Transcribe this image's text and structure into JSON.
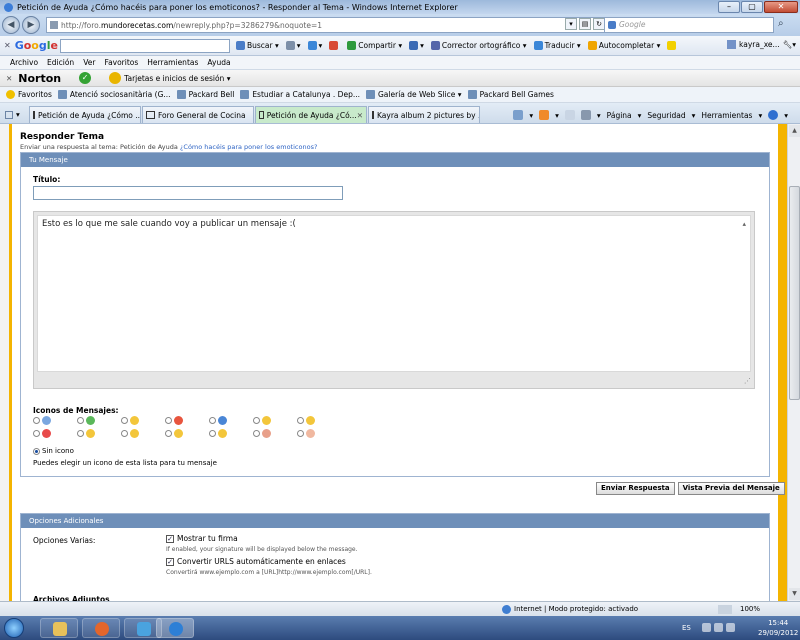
{
  "window": {
    "title": "Petición de Ayuda ¿Cómo hacéis para poner los emoticonos? - Responder al Tema - Windows Internet Explorer"
  },
  "address": {
    "url_prefix": "http://foro.",
    "url_domain": "mundorecetas.com",
    "url_rest": "/newreply.php?p=3286279&noquote=1",
    "search_placeholder": "Google"
  },
  "google_toolbar": {
    "buscar": "Buscar",
    "compartir": "Compartir",
    "corrector": "Corrector ortográfico",
    "traducir": "Traducir",
    "autocompletar": "Autocompletar",
    "user": "kayra_xe..."
  },
  "menu": [
    "Archivo",
    "Edición",
    "Ver",
    "Favoritos",
    "Herramientas",
    "Ayuda"
  ],
  "norton": {
    "logo": "Norton",
    "tarjetas": "Tarjetas e inicios de sesión"
  },
  "favorites": {
    "label": "Favoritos",
    "items": [
      "Atenció sociosanitària (G...",
      "Packard Bell",
      "Estudiar a Catalunya . Dep...",
      "Galería de Web Slice",
      "Packard Bell Games"
    ]
  },
  "tabs": [
    {
      "label": "Petición de Ayuda ¿Cómo ..."
    },
    {
      "label": "Foro General de Cocina"
    },
    {
      "label": "Petición de Ayuda ¿Có..."
    },
    {
      "label": "Kayra album 2 pictures by ..."
    }
  ],
  "commandbar": {
    "pagina": "Página",
    "seguridad": "Seguridad",
    "herramientas": "Herramientas"
  },
  "page": {
    "heading": "Responder Tema",
    "subtitle_prefix": "Enviar una respuesta al tema: Petición de Ayuda",
    "subtitle_link": "¿Cómo hacéis para poner los emoticonos?",
    "panel1_title": "Tu Mensaje",
    "titulo_label": "Título:",
    "message_text": "Esto es lo que me sale cuando voy a publicar un mensaje :(",
    "iconos_label": "Iconos de Mensajes:",
    "sin_icono": "Sin icono",
    "puedes": "Puedes elegir un icono de esta lista para tu mensaje",
    "btn_enviar": "Enviar Respuesta",
    "btn_vista": "Vista Previa del Mensaje",
    "panel2_title": "Opciones Adicionales",
    "opciones_varias": "Opciones Varias:",
    "mostrar_firma": "Mostrar tu firma",
    "mostrar_firma_note": "If enabled, your signature will be displayed below the message.",
    "convertir": "Convertir URLS automáticamente en enlaces",
    "convertir_note": "Convertirá www.ejemplo.com a [URL]http://www.ejemplo.com[/URL].",
    "archivos": "Archivos Adjuntos"
  },
  "message_icons": [
    {
      "color": "#7aa7e0"
    },
    {
      "color": "#5bb85b"
    },
    {
      "color": "#f3c63b"
    },
    {
      "color": "#e8553e"
    },
    {
      "color": "#4a86d6"
    },
    {
      "color": "#f3c63b"
    },
    {
      "color": "#f3c63b"
    },
    {
      "color": "#e84b4b"
    },
    {
      "color": "#f3c63b"
    },
    {
      "color": "#f3c63b"
    },
    {
      "color": "#f3c63b"
    },
    {
      "color": "#f3c63b"
    },
    {
      "color": "#e8a08a"
    },
    {
      "color": "#f0b8a0"
    }
  ],
  "status": {
    "zone": "Internet | Modo protegido: activado",
    "zoom": "100%"
  },
  "taskbar": {
    "lang": "ES",
    "time": "15:44",
    "date": "29/09/2012"
  }
}
